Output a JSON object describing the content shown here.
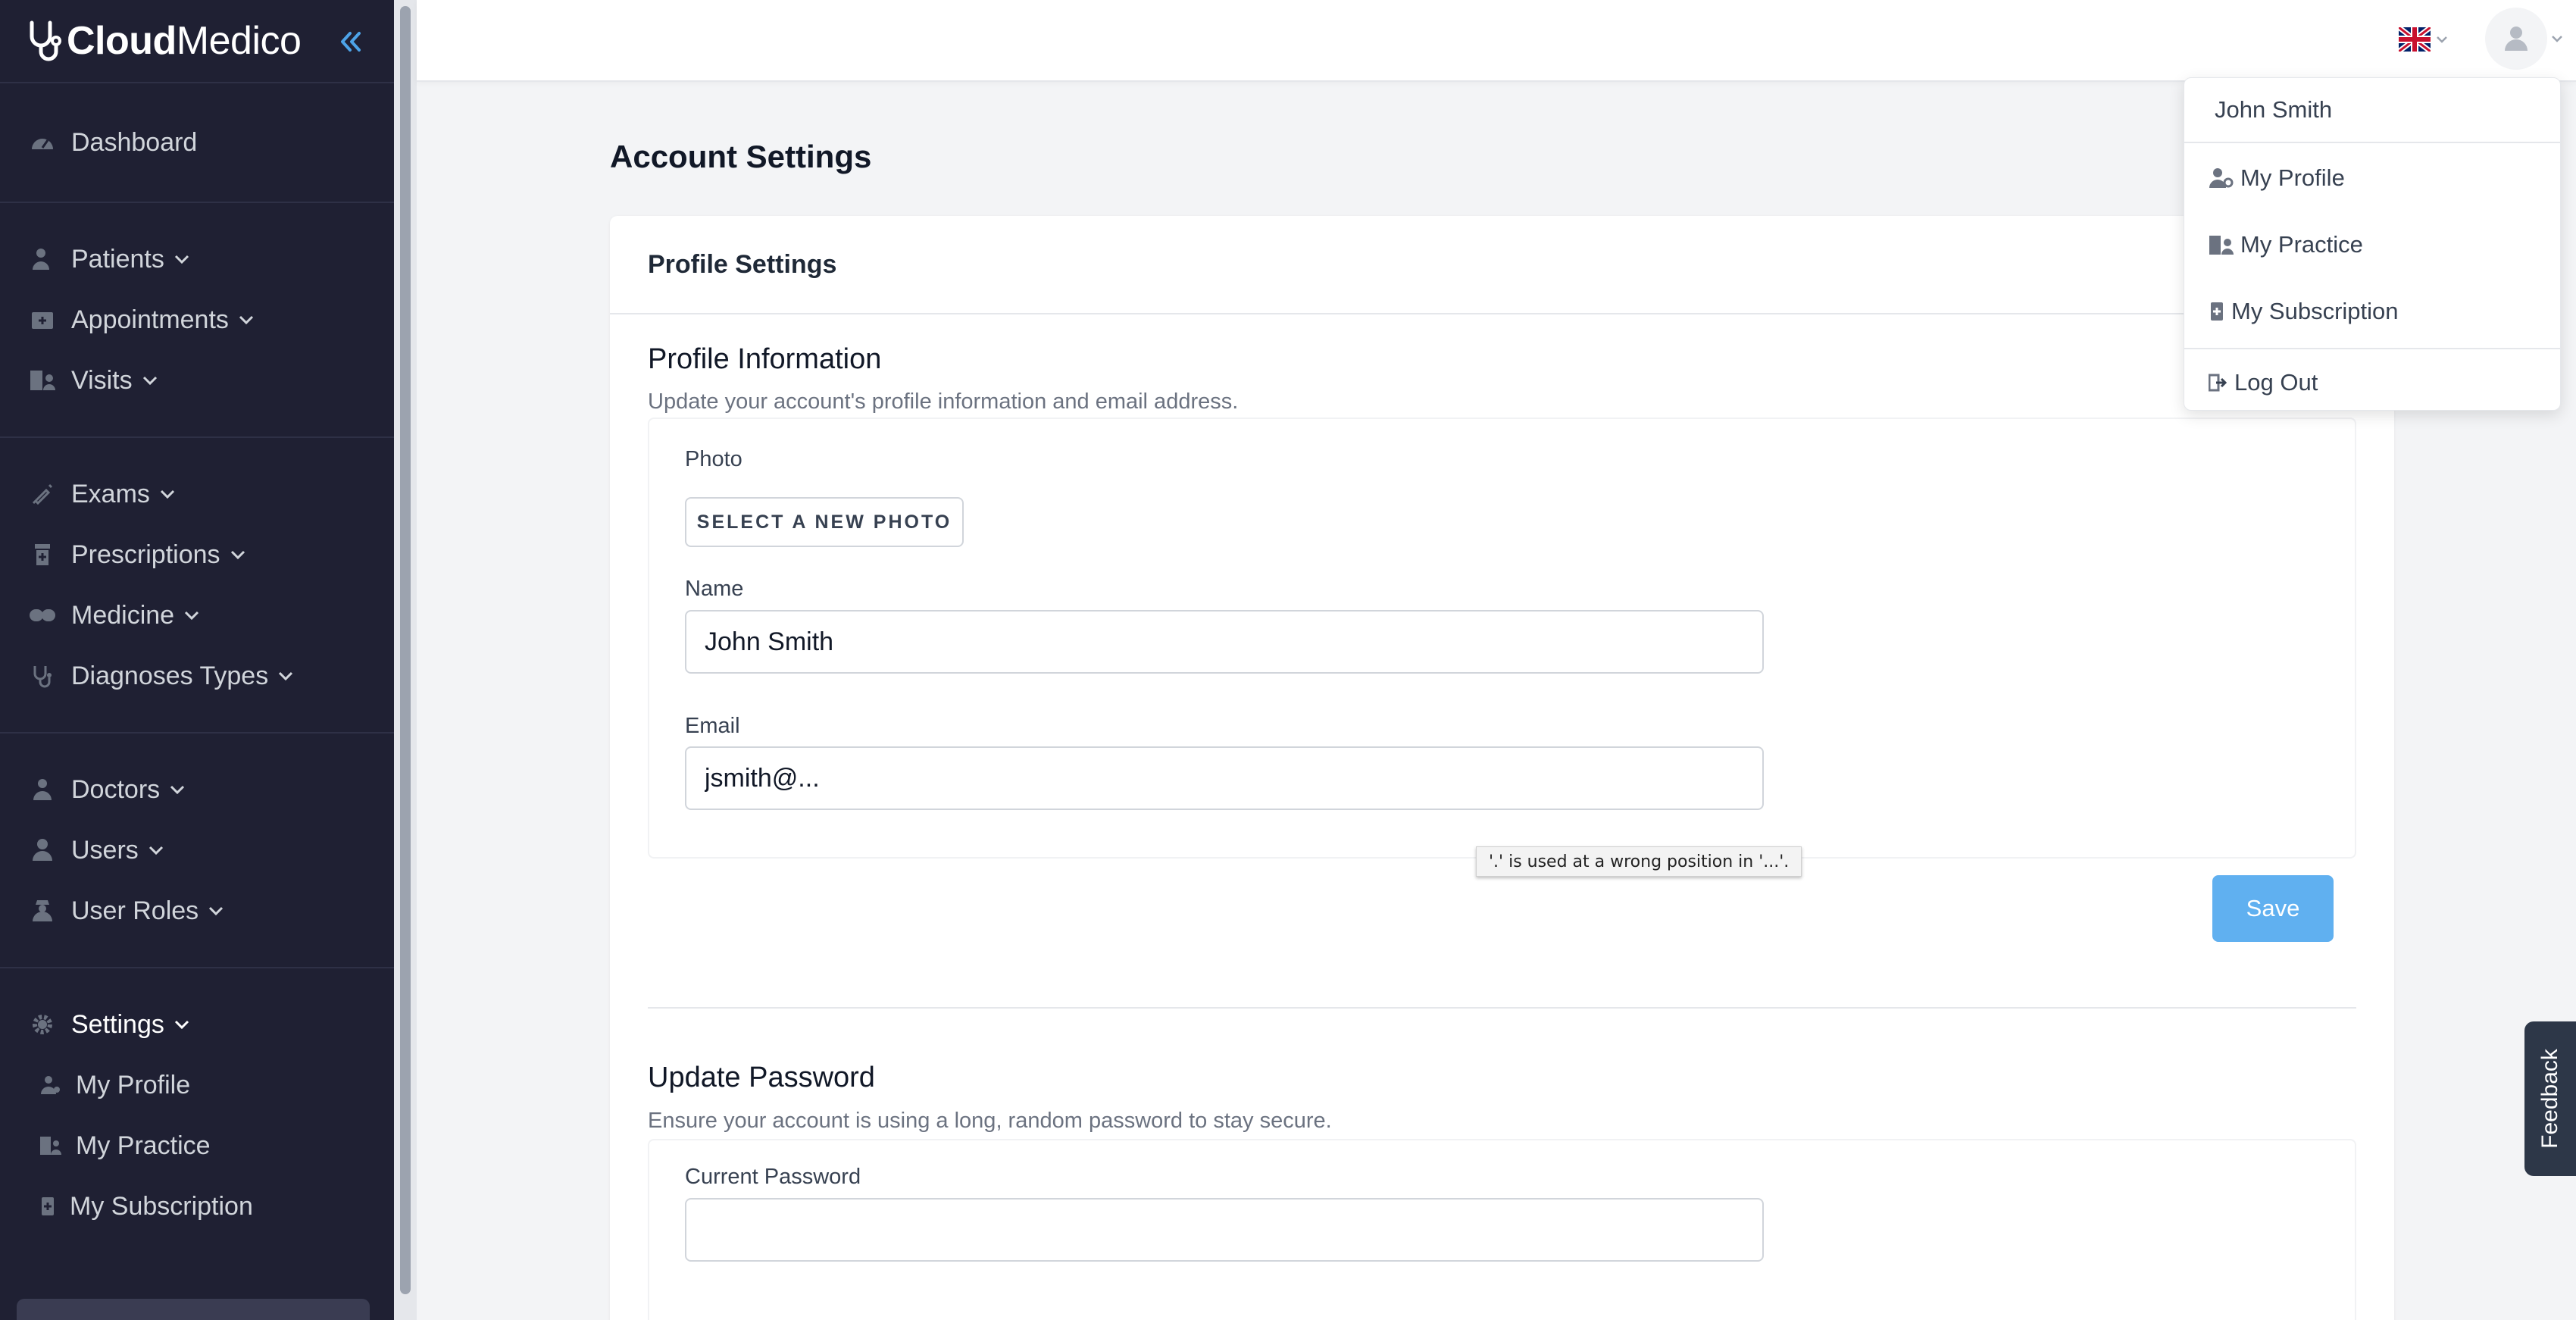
{
  "brand": {
    "part1": "Cloud",
    "part2": "Medico"
  },
  "sidebar": {
    "dashboard": "Dashboard",
    "group2": [
      "Patients",
      "Appointments",
      "Visits"
    ],
    "group3": [
      "Exams",
      "Prescriptions",
      "Medicine",
      "Diagnoses Types"
    ],
    "group4": [
      "Doctors",
      "Users",
      "User Roles"
    ],
    "settings": "Settings",
    "settings_sub": [
      "My Profile",
      "My Practice",
      "My Subscription"
    ]
  },
  "page": {
    "title": "Account Settings"
  },
  "card": {
    "header": "Profile Settings",
    "profile_info_title": "Profile Information",
    "profile_info_desc": "Update your account's profile information and email address.",
    "photo_label": "Photo",
    "photo_button": "SELECT A NEW PHOTO",
    "name_label": "Name",
    "name_value": "John Smith",
    "email_label": "Email",
    "email_value": "jsmith@...",
    "validation_tooltip": "'.' is used at a wrong position in '...'.",
    "save_button": "Save",
    "password_title": "Update Password",
    "password_desc": "Ensure your account is using a long, random password to stay secure.",
    "current_password_label": "Current Password",
    "current_password_value": ""
  },
  "user_menu": {
    "name": "John Smith",
    "items": [
      "My Profile",
      "My Practice",
      "My Subscription"
    ],
    "logout": "Log Out"
  },
  "feedback": "Feedback",
  "colors": {
    "sidebar_bg": "#1f2033",
    "accent": "#60b0f0",
    "collapse_icon": "#4da3e8"
  }
}
